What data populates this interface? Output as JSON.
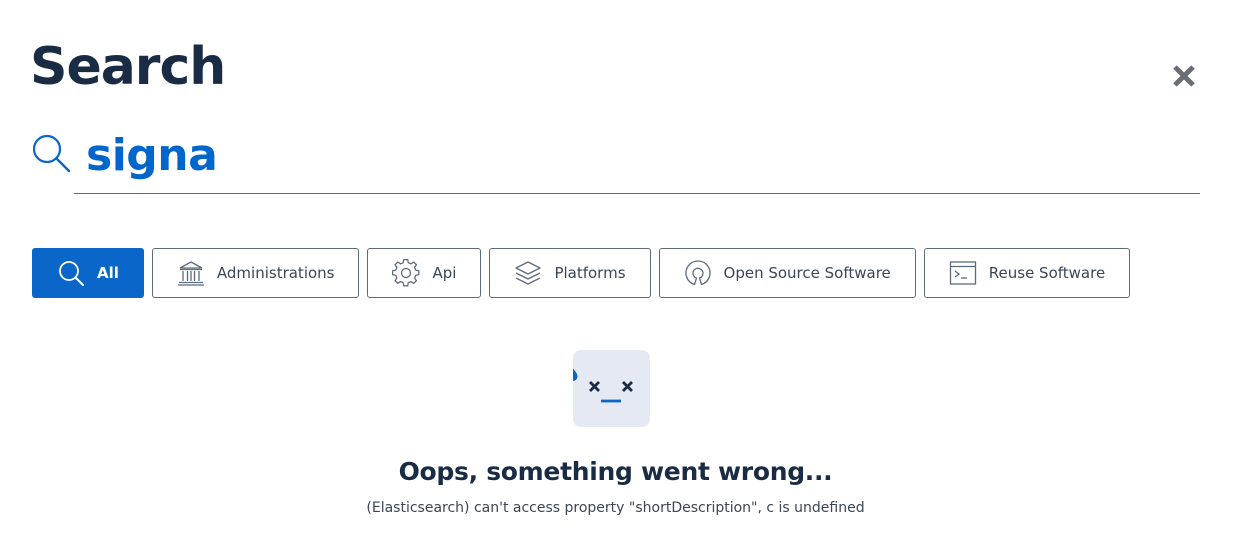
{
  "page": {
    "title": "Search"
  },
  "search": {
    "value": "signa",
    "close_icon": "close-icon",
    "search_icon": "search-icon"
  },
  "filters": [
    {
      "label": "All",
      "icon": "search-icon",
      "active": true
    },
    {
      "label": "Administrations",
      "icon": "building-icon",
      "active": false
    },
    {
      "label": "Api",
      "icon": "gear-icon",
      "active": false
    },
    {
      "label": "Platforms",
      "icon": "layers-icon",
      "active": false
    },
    {
      "label": "Open Source Software",
      "icon": "open-source-icon",
      "active": false
    },
    {
      "label": "Reuse Software",
      "icon": "terminal-icon",
      "active": false
    }
  ],
  "error": {
    "title": "Oops, something went wrong...",
    "message": "(Elasticsearch) can't access property \"shortDescription\", c is undefined",
    "face_icon": "dizzy-face-icon"
  },
  "colors": {
    "primary": "#0a66c8",
    "text_dark": "#1a2b44",
    "border": "#5b6b7d",
    "face_bg": "#e4e9f4"
  }
}
